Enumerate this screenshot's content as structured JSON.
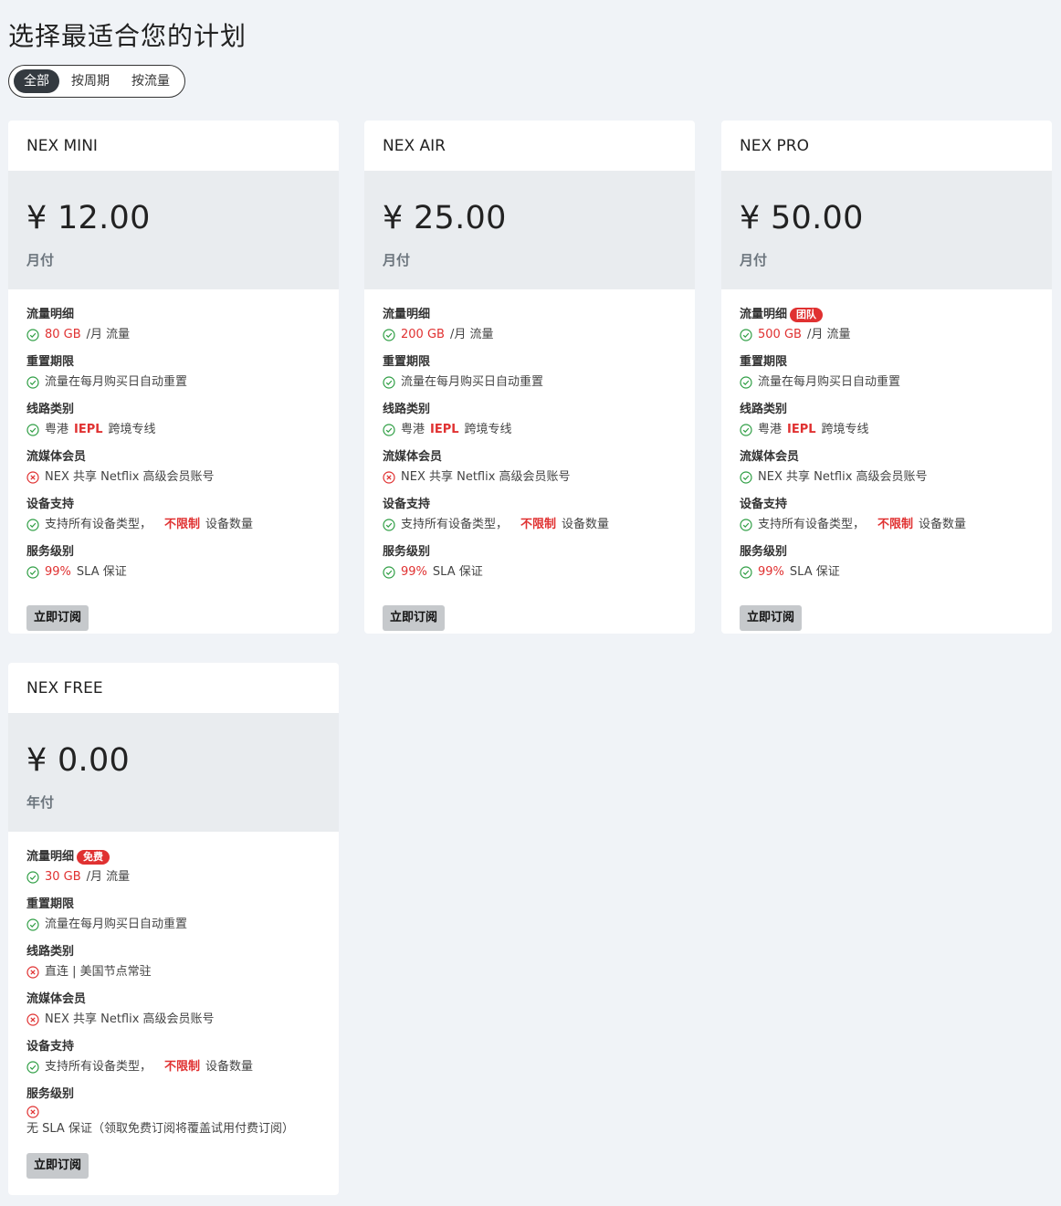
{
  "page": {
    "title": "选择最适合您的计划",
    "filters": [
      "全部",
      "按周期",
      "按流量"
    ]
  },
  "labels": {
    "traffic": "流量明细",
    "reset": "重置期限",
    "line": "线路类别",
    "stream": "流媒体会员",
    "device": "设备支持",
    "service": "服务级别",
    "subscribe": "立即订阅",
    "per_month_traffic": "/月 流量",
    "reset_text": "流量在每月购买日自动重置",
    "line_prefix": "粤港",
    "line_hl": "IEPL",
    "line_suffix": "跨境专线",
    "stream_text": "NEX 共享 Netflix 高级会员账号",
    "device_prefix": "支持所有设备类型，",
    "device_hl": "不限制",
    "device_suffix": "设备数量",
    "sla_suffix": "SLA 保证"
  },
  "plans": [
    {
      "name": "NEX MINI",
      "price": "¥ 12.00",
      "period": "月付",
      "traffic": "80 GB",
      "sla": "99%"
    },
    {
      "name": "NEX AIR",
      "price": "¥ 25.00",
      "period": "月付",
      "traffic": "200 GB",
      "sla": "99%"
    },
    {
      "name": "NEX PRO",
      "price": "¥ 50.00",
      "period": "月付",
      "traffic": "500 GB",
      "badge": "团队",
      "sla": "99%"
    },
    {
      "name": "NEX FREE",
      "price": "¥ 0.00",
      "period": "年付",
      "traffic": "30 GB",
      "badge": "免费",
      "line_text": "直连 | 美国节点常驻",
      "sla_text": "无 SLA 保证（领取免费订阅将覆盖试用付费订阅）"
    }
  ],
  "colors": {
    "check": "#2f9e44",
    "cross": "#e03131",
    "accent": "#e03131"
  }
}
